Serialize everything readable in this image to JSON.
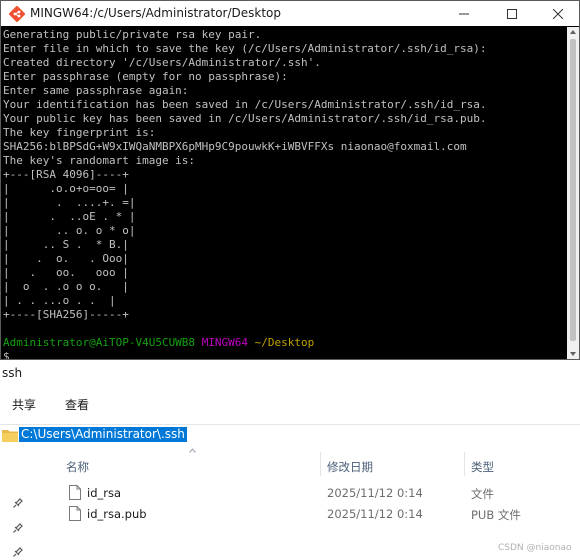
{
  "terminal": {
    "title": "MINGW64:/c/Users/Administrator/Desktop",
    "lines": [
      "Generating public/private rsa key pair.",
      "Enter file in which to save the key (/c/Users/Administrator/.ssh/id_rsa):",
      "Created directory '/c/Users/Administrator/.ssh'.",
      "Enter passphrase (empty for no passphrase):",
      "Enter same passphrase again:",
      "Your identification has been saved in /c/Users/Administrator/.ssh/id_rsa.",
      "Your public key has been saved in /c/Users/Administrator/.ssh/id_rsa.pub.",
      "The key fingerprint is:",
      "SHA256:blBPSdG+W9xIWQaNMBPX6pMHp9C9pouwkK+iWBVFFXs niaonao@foxmail.com",
      "The key's randomart image is:",
      "+---[RSA 4096]----+",
      "|      .o.o+o=oo= |",
      "|       .  ....+. =|",
      "|      .  ..oE . * |",
      "|       .. o. o * o|",
      "|     .. S .  * B.|",
      "|    .  o.   . Ooo|",
      "|   .   oo.   ooo |",
      "|  o  . .o o o.   |",
      "| . . ...o . .  |",
      "+----[SHA256]-----+",
      ""
    ],
    "prompt": {
      "user_host": "Administrator@AiTOP-V4U5CUWB8",
      "msystem": "MINGW64",
      "path": "~/Desktop",
      "symbol": "$"
    },
    "colors": {
      "background": "#000000",
      "text": "#c0c0c0",
      "user": "#13a10e",
      "msystem": "#c000c0",
      "path": "#c0a000"
    }
  },
  "explorer": {
    "window_title": "ssh",
    "ribbon_tabs": [
      "共享",
      "查看"
    ],
    "address": "C:\\Users\\Administrator\\.ssh",
    "columns": {
      "name": "名称",
      "date": "修改日期",
      "type": "类型"
    },
    "files": [
      {
        "name": "id_rsa",
        "date": "2025/11/12 0:14",
        "type": "文件"
      },
      {
        "name": "id_rsa.pub",
        "date": "2025/11/12 0:14",
        "type": "PUB 文件"
      }
    ],
    "selection_color": "#0078d7"
  },
  "watermark": "CSDN @niaonao"
}
